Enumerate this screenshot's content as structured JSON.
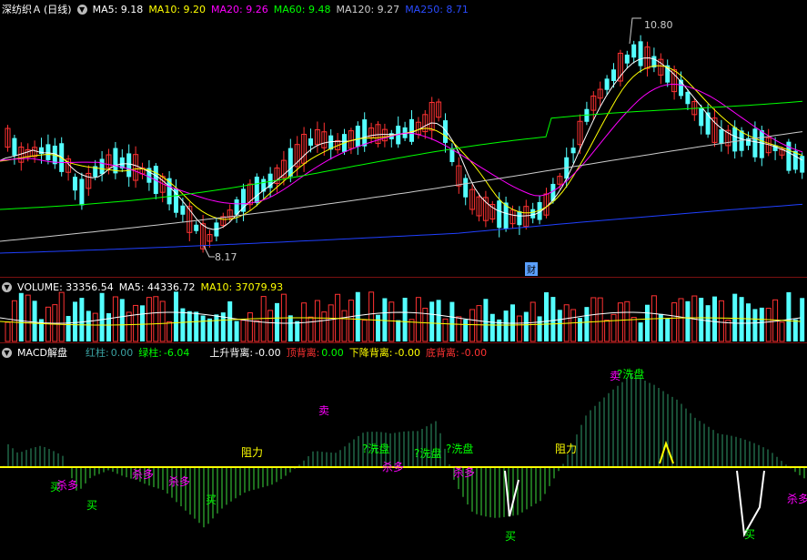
{
  "price": {
    "stock_name": "深纺织Ａ",
    "period": "(日线)",
    "ma": [
      {
        "label": "MA5: 9.18",
        "color": "#ffffff"
      },
      {
        "label": "MA10: 9.20",
        "color": "#ffff00"
      },
      {
        "label": "MA20: 9.26",
        "color": "#ff00ff"
      },
      {
        "label": "MA60: 9.48",
        "color": "#00ff00"
      },
      {
        "label": "MA120: 9.27",
        "color": "#cccccc"
      },
      {
        "label": "MA250: 8.71",
        "color": "#2040ff"
      }
    ],
    "high_label": "10.80",
    "low_label": "8.17",
    "event_badge": "财"
  },
  "volume": {
    "title": "VOLUME: 33356.54",
    "ma5": "MA5: 44336.72",
    "ma10": "MA10: 37079.93"
  },
  "macd": {
    "title": "MACD解盘",
    "red_bar": {
      "label": "红柱:",
      "value": "0.00"
    },
    "green_bar": {
      "label": "绿柱:",
      "value": "-6.04"
    },
    "rise_div": {
      "label": "上升背离:",
      "value": "-0.00"
    },
    "top_div": {
      "label": "顶背离:",
      "value": "0.00"
    },
    "fall_div": {
      "label": "下降背离:",
      "value": "-0.00"
    },
    "bottom_div": {
      "label": "底背离:",
      "value": "-0.00"
    },
    "signals": {
      "buy": "买",
      "sell": "卖",
      "resist": "阻力",
      "wash": "?洗盘",
      "kill": "杀多"
    }
  },
  "colors": {
    "up": "#ff3232",
    "down": "#54ffff",
    "green_bar": "#00ff00",
    "yellow": "#ffff00"
  }
}
